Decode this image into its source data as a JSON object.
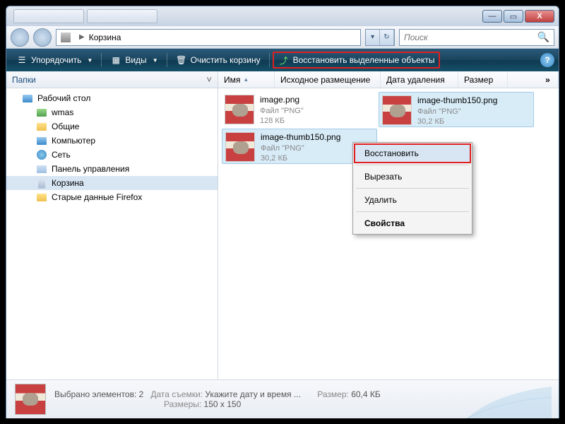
{
  "address": {
    "location": "Корзина"
  },
  "search": {
    "placeholder": "Поиск"
  },
  "toolbar": {
    "organize": "Упорядочить",
    "views": "Виды",
    "empty": "Очистить корзину",
    "restore": "Восстановить выделенные объекты"
  },
  "sidebar": {
    "header": "Папки",
    "items": [
      {
        "label": "Рабочий стол",
        "icon": "monitor",
        "level": 1
      },
      {
        "label": "wmas",
        "icon": "folder-green",
        "level": 2
      },
      {
        "label": "Общие",
        "icon": "folder",
        "level": 2
      },
      {
        "label": "Компьютер",
        "icon": "monitor",
        "level": 2
      },
      {
        "label": "Сеть",
        "icon": "world",
        "level": 2
      },
      {
        "label": "Панель управления",
        "icon": "panel",
        "level": 2
      },
      {
        "label": "Корзина",
        "icon": "bin",
        "level": 2,
        "selected": true
      },
      {
        "label": "Старые данные Firefox",
        "icon": "folder",
        "level": 2
      }
    ]
  },
  "columns": {
    "name": "Имя",
    "orig": "Исходное размещение",
    "deleted": "Дата удаления",
    "size": "Размер",
    "more": "»"
  },
  "files": [
    {
      "name": "image.png",
      "type": "Файл \"PNG\"",
      "size": "128 КБ",
      "selected": false
    },
    {
      "name": "image-thumb150.png",
      "type": "Файл \"PNG\"",
      "size": "30,2 КБ",
      "selected": true
    },
    {
      "name": "image-thumb150.png",
      "type": "Файл \"PNG\"",
      "size": "30,2 КБ",
      "selected": true
    }
  ],
  "context_menu": {
    "restore": "Восстановить",
    "cut": "Вырезать",
    "delete": "Удалить",
    "properties": "Свойства"
  },
  "details": {
    "selected_label": "Выбрано элементов:",
    "selected_count": "2",
    "date_label": "Дата съемки:",
    "date_value": "Укажите дату и время ...",
    "size_label": "Размер:",
    "size_value": "60,4 КБ",
    "dims_label": "Размеры:",
    "dims_value": "150 x 150"
  }
}
